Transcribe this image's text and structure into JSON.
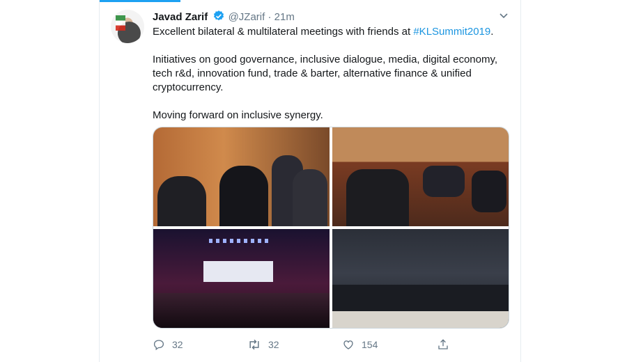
{
  "tweet": {
    "author_name": "Javad Zarif",
    "handle": "@JZarif",
    "separator": "·",
    "time": "21m",
    "line1_prefix": "Excellent bilateral & multilateral meetings with friends at ",
    "hashtag": "#KLSummit2019",
    "line1_suffix": ".",
    "paragraph2": "Initiatives on good governance, inclusive dialogue, media, digital economy, tech r&d, innovation fund, trade & barter, alternative finance & unified cryptocurrency.",
    "paragraph3": "Moving forward on inclusive synergy."
  },
  "icons": {
    "verified": "verified-badge-icon",
    "more": "chevron-down-icon",
    "reply": "reply-icon",
    "retweet": "retweet-icon",
    "like": "heart-icon",
    "share": "share-icon"
  },
  "actions": {
    "replies": "32",
    "retweets": "32",
    "likes": "154"
  },
  "colors": {
    "accent": "#1da1f2",
    "hashtag": "#1b95e0",
    "muted": "#657786"
  }
}
